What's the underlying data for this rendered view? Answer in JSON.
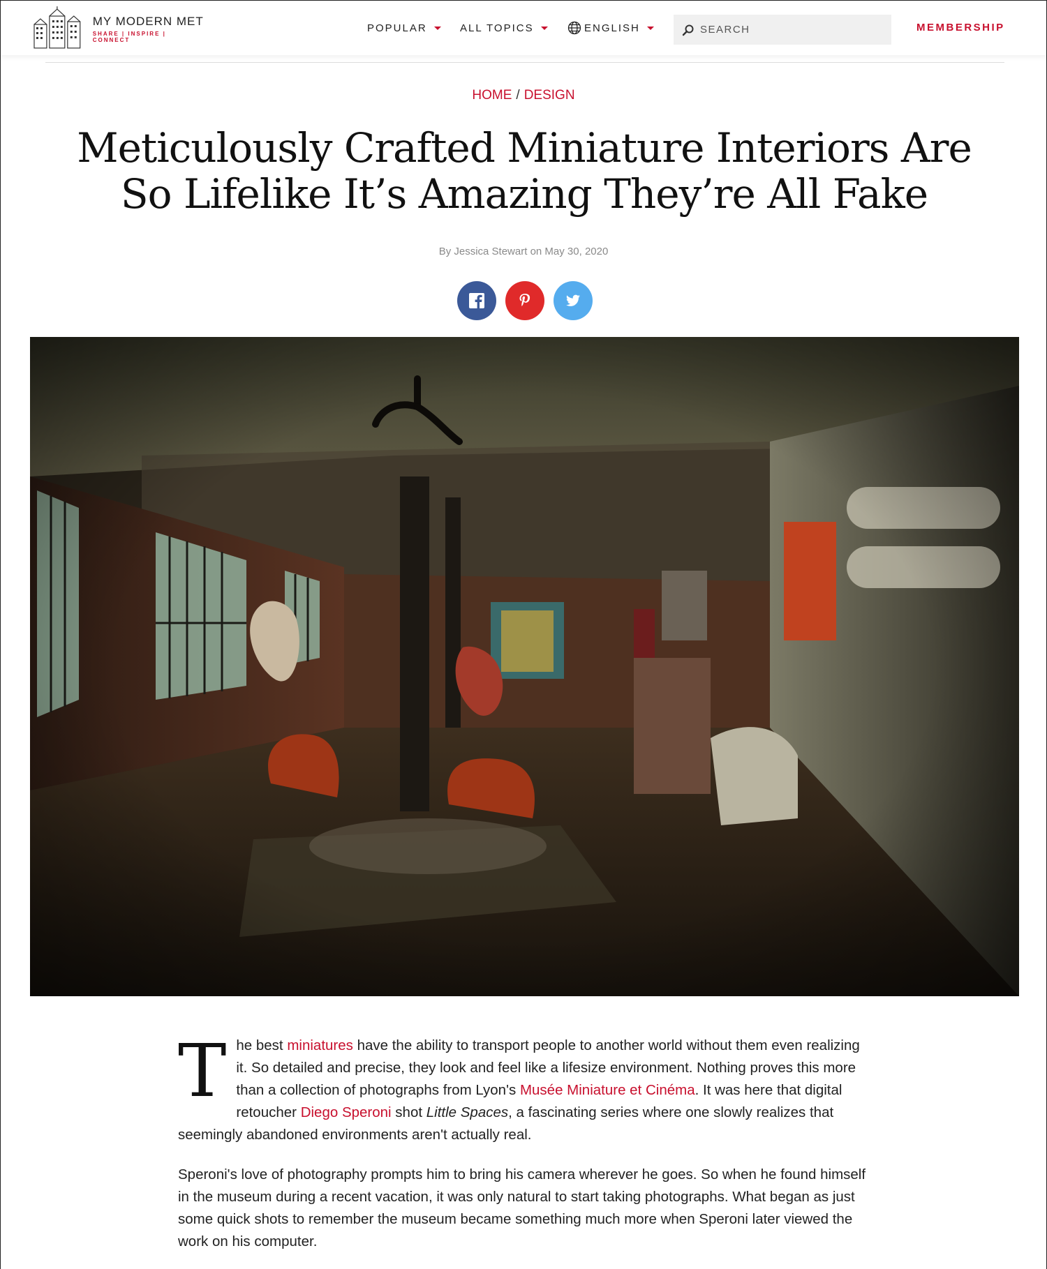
{
  "header": {
    "logo": {
      "name": "MY MODERN MET",
      "tagline": "SHARE | INSPIRE | CONNECT"
    },
    "nav": [
      {
        "label": "POPULAR",
        "icon": "caret-down-icon"
      },
      {
        "label": "ALL TOPICS",
        "icon": "caret-down-icon"
      },
      {
        "label": "ENGLISH",
        "icon": "globe-icon"
      }
    ],
    "search": {
      "placeholder": "SEARCH",
      "icon": "search-icon"
    },
    "membership": "MEMBERSHIP"
  },
  "breadcrumb": {
    "home": "HOME",
    "separator": "/",
    "section": "DESIGN"
  },
  "article": {
    "title": "Meticulously Crafted Miniature Interiors Are So Lifelike It’s Amazing They’re All Fake",
    "byline": "By Jessica Stewart on May 30, 2020",
    "share": [
      {
        "name": "facebook",
        "icon": "facebook-icon",
        "color": "#3b5998"
      },
      {
        "name": "pinterest",
        "icon": "pinterest-icon",
        "color": "#e02a2a"
      },
      {
        "name": "twitter",
        "icon": "twitter-icon",
        "color": "#55acee"
      }
    ],
    "hero_alt": "miniature loft interior photograph",
    "p1": {
      "dropcap": "T",
      "t1": "he best ",
      "link1": "miniatures",
      "t2": " have the ability to transport people to another world without them even realizing it. So detailed and precise, they look and feel like a lifesize environment. Nothing proves this more than a collection of photographs from Lyon's ",
      "link2": "Musée Miniature et Cinéma",
      "t3": ". It was here that digital retoucher ",
      "link3": "Diego Speroni",
      "t4": " shot ",
      "em": "Little Spaces",
      "t5": ", a fascinating series where one slowly realizes that seemingly abandoned environments aren't actually real."
    },
    "p2": "Speroni's love of photography prompts him to bring his camera wherever he goes. So when he found himself in the museum during a recent vacation, it was only natural to start taking photographs. What began as just some quick shots to remember the museum became something much more when Speroni later viewed the work on his computer."
  },
  "colors": {
    "accent": "#c8102e",
    "text": "#222222",
    "muted": "#8a8a8a"
  }
}
